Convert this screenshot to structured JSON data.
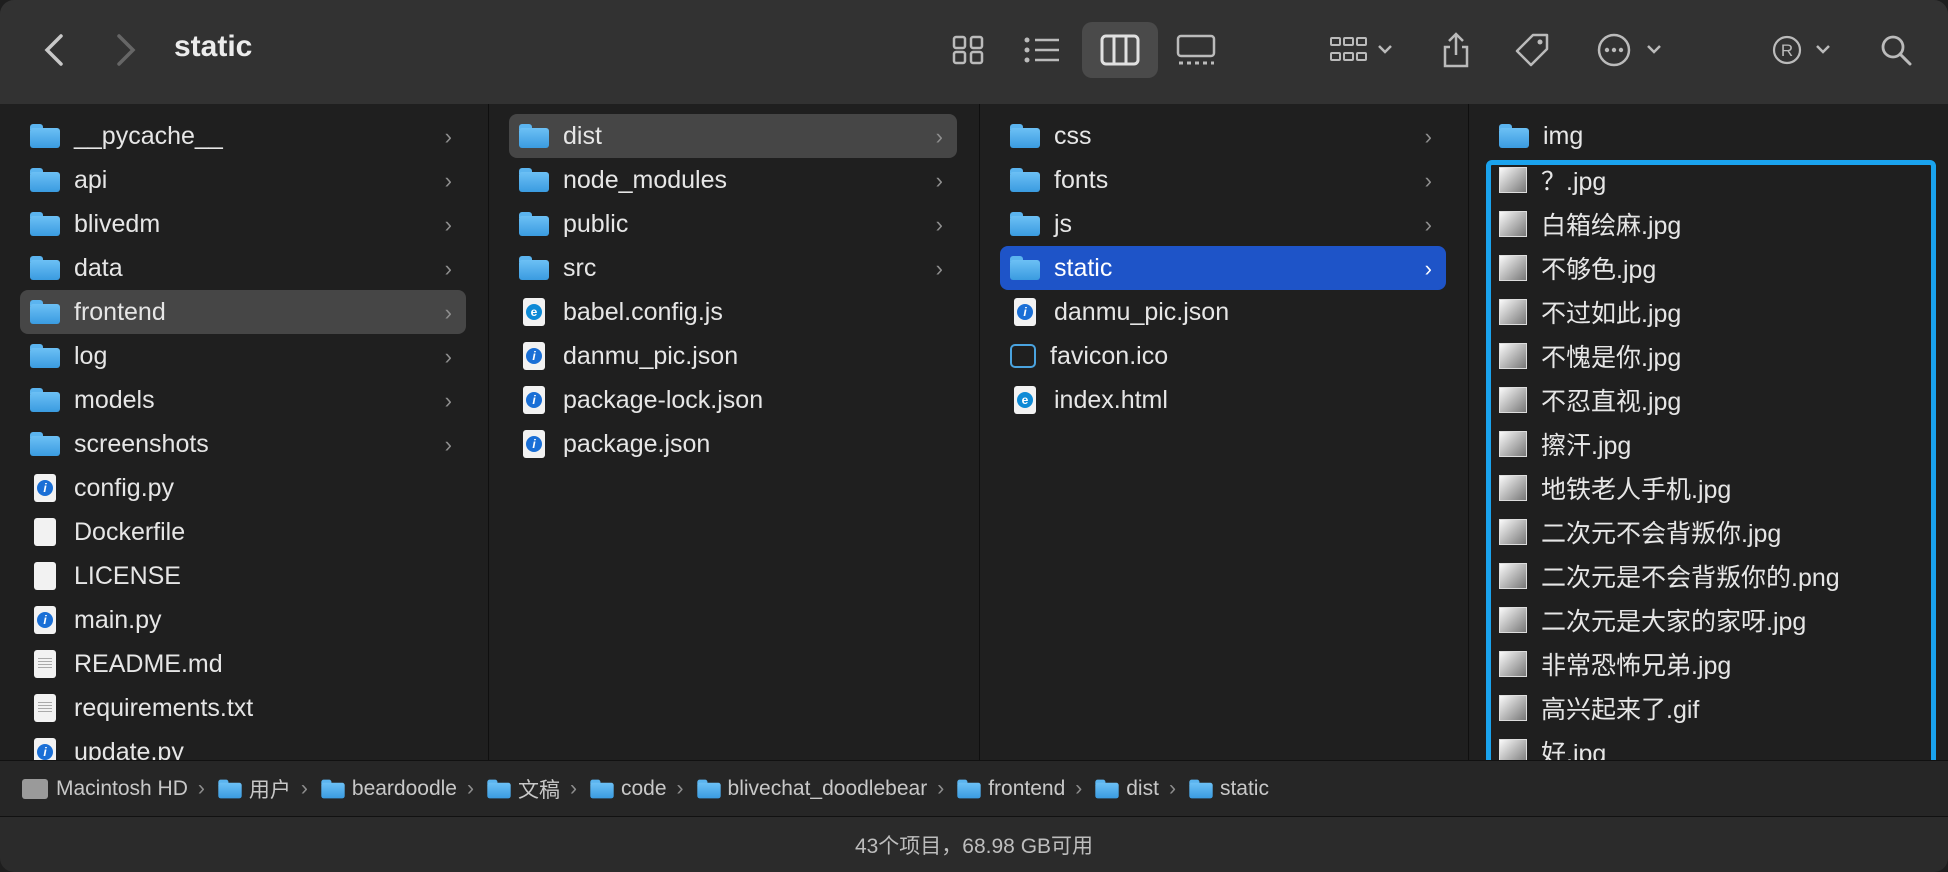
{
  "window": {
    "title": "static"
  },
  "toolbar": {
    "back": "back",
    "forward": "forward",
    "views": [
      "icon-view",
      "list-view",
      "column-view",
      "gallery-view"
    ],
    "active_view": "column-view"
  },
  "columns": [
    {
      "items": [
        {
          "label": "__pycache__",
          "type": "folder",
          "chevron": "›"
        },
        {
          "label": "api",
          "type": "folder",
          "chevron": "›"
        },
        {
          "label": "blivedm",
          "type": "folder",
          "chevron": "›"
        },
        {
          "label": "data",
          "type": "folder",
          "chevron": "›"
        },
        {
          "label": "frontend",
          "type": "folder",
          "chevron": "›",
          "selected": "gray"
        },
        {
          "label": "log",
          "type": "folder",
          "chevron": "›"
        },
        {
          "label": "models",
          "type": "folder",
          "chevron": "›"
        },
        {
          "label": "screenshots",
          "type": "folder",
          "chevron": "›"
        },
        {
          "label": "config.py",
          "type": "py"
        },
        {
          "label": "Dockerfile",
          "type": "doc"
        },
        {
          "label": "LICENSE",
          "type": "doc"
        },
        {
          "label": "main.py",
          "type": "py"
        },
        {
          "label": "README.md",
          "type": "txt"
        },
        {
          "label": "requirements.txt",
          "type": "txt"
        },
        {
          "label": "update.py",
          "type": "py"
        }
      ]
    },
    {
      "items": [
        {
          "label": "dist",
          "type": "folder",
          "chevron": "›",
          "selected": "gray"
        },
        {
          "label": "node_modules",
          "type": "folder",
          "chevron": "›"
        },
        {
          "label": "public",
          "type": "folder",
          "chevron": "›"
        },
        {
          "label": "src",
          "type": "folder",
          "chevron": "›"
        },
        {
          "label": "babel.config.js",
          "type": "edge"
        },
        {
          "label": "danmu_pic.json",
          "type": "py"
        },
        {
          "label": "package-lock.json",
          "type": "py"
        },
        {
          "label": "package.json",
          "type": "py"
        }
      ]
    },
    {
      "items": [
        {
          "label": "css",
          "type": "folder",
          "chevron": "›"
        },
        {
          "label": "fonts",
          "type": "folder",
          "chevron": "›"
        },
        {
          "label": "js",
          "type": "folder",
          "chevron": "›"
        },
        {
          "label": "static",
          "type": "folder",
          "chevron": "›",
          "selected": "blue"
        },
        {
          "label": "danmu_pic.json",
          "type": "py"
        },
        {
          "label": "favicon.ico",
          "type": "fav"
        },
        {
          "label": "index.html",
          "type": "edge"
        }
      ]
    },
    {
      "items": [
        {
          "label": "img",
          "type": "folder"
        },
        {
          "label": "？.jpg",
          "type": "thumb"
        },
        {
          "label": "白箱绘麻.jpg",
          "type": "thumb"
        },
        {
          "label": "不够色.jpg",
          "type": "thumb"
        },
        {
          "label": "不过如此.jpg",
          "type": "thumb"
        },
        {
          "label": "不愧是你.jpg",
          "type": "thumb"
        },
        {
          "label": "不忍直视.jpg",
          "type": "thumb"
        },
        {
          "label": "擦汗.jpg",
          "type": "thumb"
        },
        {
          "label": "地铁老人手机.jpg",
          "type": "thumb"
        },
        {
          "label": "二次元不会背叛你.jpg",
          "type": "thumb"
        },
        {
          "label": "二次元是不会背叛你的.png",
          "type": "thumb"
        },
        {
          "label": "二次元是大家的家呀.jpg",
          "type": "thumb"
        },
        {
          "label": "非常恐怖兄弟.jpg",
          "type": "thumb"
        },
        {
          "label": "高兴起来了.gif",
          "type": "thumb"
        },
        {
          "label": "好.jpg",
          "type": "thumb"
        }
      ]
    }
  ],
  "pathbar": [
    "Macintosh HD",
    "用户",
    "beardoodle",
    "文稿",
    "code",
    "blivechat_doodlebear",
    "frontend",
    "dist",
    "static"
  ],
  "status": "43个项目，68.98 GB可用",
  "colors": {
    "selection_blue": "#1e54c8",
    "highlight_box": "#1aa3ee",
    "folder": "#5bb4ef"
  }
}
